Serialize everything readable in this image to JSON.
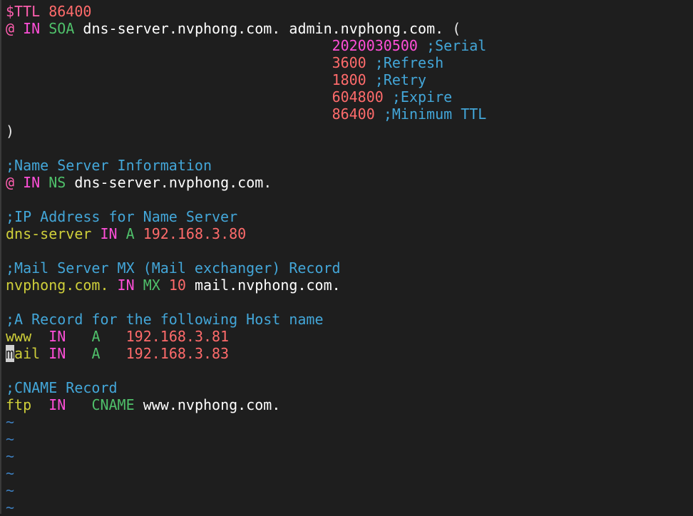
{
  "file": {
    "line1": {
      "var": "$TTL",
      "value": "86400"
    },
    "line2": {
      "at": "@",
      "class": "IN",
      "type": "SOA",
      "primary": "dns-server.nvphong.com.",
      "admin": "admin.nvphong.com.",
      "open": "("
    },
    "soa": [
      {
        "value": "2020030500",
        "comment": ";Serial"
      },
      {
        "value": "3600",
        "comment": ";Refresh"
      },
      {
        "value": "1800",
        "comment": ";Retry"
      },
      {
        "value": "604800",
        "comment": ";Expire"
      },
      {
        "value": "86400",
        "comment": ";Minimum TTL"
      }
    ],
    "close": ")",
    "ns_comment": ";Name Server Information",
    "ns": {
      "at": "@",
      "class": "IN",
      "type": "NS",
      "target": "dns-server.nvphong.com."
    },
    "ip_comment": ";IP Address for Name Server",
    "ip": {
      "host": "dns-server",
      "class": "IN",
      "type": "A",
      "addr": "192.168.3.80"
    },
    "mx_comment": ";Mail Server MX (Mail exchanger) Record",
    "mx": {
      "host": "nvphong.com.",
      "class": "IN",
      "type": "MX",
      "prio": "10",
      "target": "mail.nvphong.com."
    },
    "a_comment": ";A Record for the following Host name",
    "a_records": [
      {
        "host": "www",
        "class": "IN",
        "type": "A",
        "addr": "192.168.3.81"
      },
      {
        "host_cursor": "m",
        "host_rest": "ail",
        "class": "IN",
        "type": "A",
        "addr": "192.168.3.83"
      }
    ],
    "cname_comment": ";CNAME Record",
    "cname": {
      "host": "ftp",
      "class": "IN",
      "type": "CNAME",
      "target": "www.nvphong.com."
    },
    "tilde": "~"
  },
  "colors": {
    "background": "#1e1e1e",
    "comment": "#43a6d8",
    "keyword": "#ff4fd8",
    "number": "#ff6b6b",
    "type": "#4fc06a",
    "identifier": "#cfcf3a"
  }
}
